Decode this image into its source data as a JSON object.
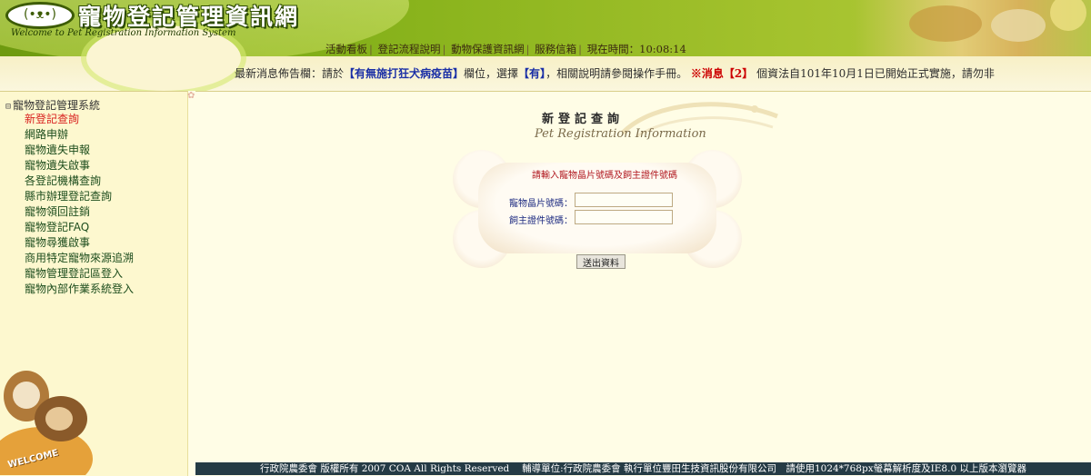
{
  "header": {
    "logo_glyph": "(•ᴥ•)",
    "title": "寵物登記管理資訊網",
    "subtitle": "Welcome to Pet Registration Information System"
  },
  "topnav": {
    "items": [
      "活動看板",
      "登記流程說明",
      "動物保護資訊網",
      "服務信箱"
    ],
    "time_label": "現在時間：10:08:14"
  },
  "marquee": {
    "prefix": "最新消息佈告欄：請於",
    "hl1": "【有無施打狂犬病疫苗】",
    "mid1": "欄位，選擇",
    "hl2": "【有】",
    "mid2": "，相關說明請參閱操作手冊。",
    "alert": "※消息【2】",
    "suffix": " 個資法自101年10月1日已開始正式實施，請勿非"
  },
  "sidebar": {
    "root_toggle": "⊟",
    "root_label": "寵物登記管理系統",
    "items": [
      "新登記查詢",
      "網路申辦",
      "寵物遺失申報",
      "寵物遺失啟事",
      "各登記機構查詢",
      "縣市辦理登記查詢",
      "寵物領回註銷",
      "寵物登記FAQ",
      "寵物尋獲啟事",
      "商用特定寵物來源追溯",
      "寵物管理登記區登入",
      "寵物內部作業系統登入"
    ],
    "welcome_text": "WELCOME"
  },
  "form": {
    "title": "新登記查詢",
    "subtitle": "Pet Registration Information",
    "hint": "請輸入寵物晶片號碼及飼主證件號碼",
    "chip_label": "寵物晶片號碼：",
    "chip_value": "",
    "owner_label": "飼主證件號碼：",
    "owner_value": "",
    "submit_label": "送出資料"
  },
  "footer": {
    "text": "行政院農委會 版權所有 2007 COA All Rights Reserved　 輔導單位:行政院農委會 執行單位豐田生技資訊股份有限公司　請使用1024*768px螢幕解析度及IE8.0 以上版本瀏覽器"
  },
  "colors": {
    "header_green": "#87b21b",
    "sidebar_bg": "#fdf8cf",
    "main_bg": "#fffde6",
    "menu_text": "#1d4d1d",
    "menu_active": "#d9221f",
    "footer_bg": "#253b45"
  }
}
